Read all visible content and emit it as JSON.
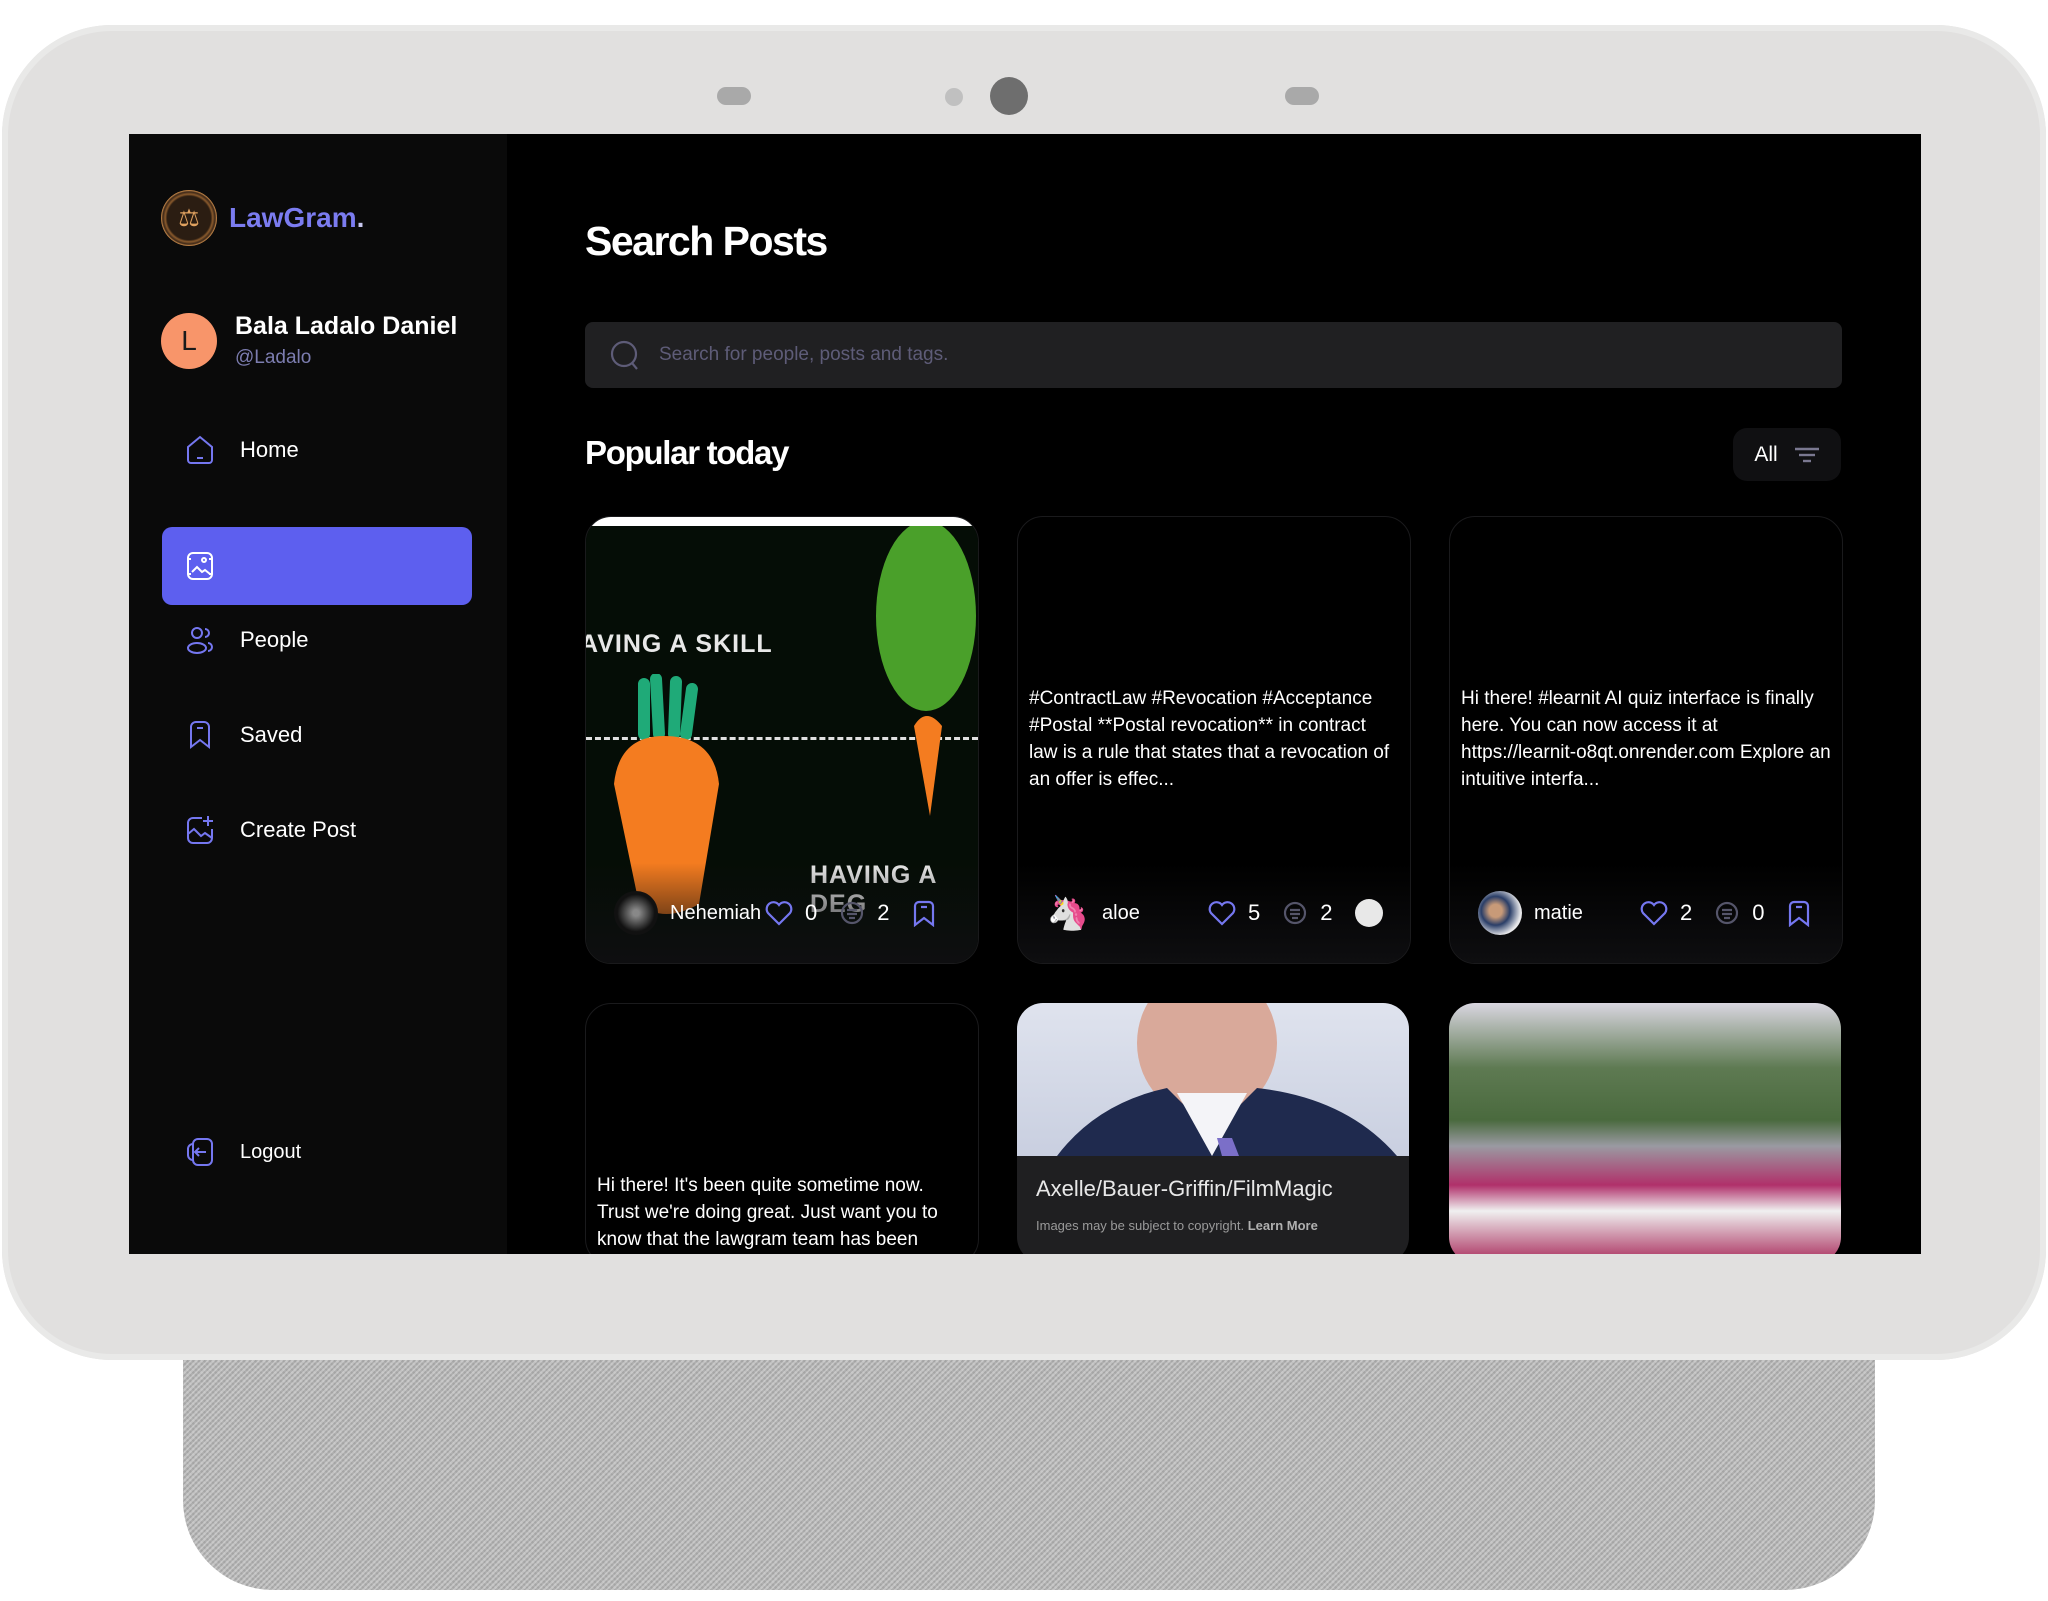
{
  "app": {
    "name": "LawGram",
    "name_suffix": "."
  },
  "user": {
    "initial": "L",
    "name": "Bala Ladalo Daniel",
    "handle": "@Ladalo"
  },
  "sidebar": {
    "items": [
      {
        "label": "Home",
        "icon": "home-icon",
        "active": false
      },
      {
        "label": "",
        "icon": "gallery-icon",
        "active": true
      },
      {
        "label": "People",
        "icon": "people-icon",
        "active": false
      },
      {
        "label": "Saved",
        "icon": "bookmark-icon",
        "active": false
      },
      {
        "label": "Create Post",
        "icon": "add-image-icon",
        "active": false
      }
    ],
    "logout": {
      "label": "Logout",
      "icon": "logout-icon"
    }
  },
  "main": {
    "title": "Search Posts",
    "search": {
      "placeholder": "Search for people, posts and tags.",
      "value": ""
    },
    "section_title": "Popular today",
    "filter": {
      "label": "All",
      "icon": "filter-icon"
    }
  },
  "posts": [
    {
      "author": "Nehemiah",
      "likes": "0",
      "comments": "2",
      "image_text": [
        "AVING  A SKILL",
        "HAVING  A DEG"
      ],
      "text": ""
    },
    {
      "author": "aloe",
      "likes": "5",
      "comments": "2",
      "text": "#ContractLaw #Revocation #Acceptance #Postal **Postal revocation** in contract law is a rule that states that a revocation of an offer is effec..."
    },
    {
      "author": "matie",
      "likes": "2",
      "comments": "0",
      "text": "Hi there! #learnit AI quiz interface is finally here. You can now access it at https://learnit-o8qt.onrender.com Explore an intuitive interfa..."
    },
    {
      "text": "Hi there! It's been quite sometime now. Trust we're doing great. Just want you to know that the lawgram team has been"
    },
    {
      "caption_title": "Axelle/Bauer-Griffin/FilmMagic",
      "caption_sub": "Images may be subject to copyright.",
      "caption_link": "Learn More"
    },
    {
      "image": "group-wedding-photo"
    }
  ],
  "colors": {
    "accent": "#5d5fef",
    "sidebar_bg": "#0a0a0a",
    "search_bg": "#202022",
    "avatar": "#f8956a"
  }
}
